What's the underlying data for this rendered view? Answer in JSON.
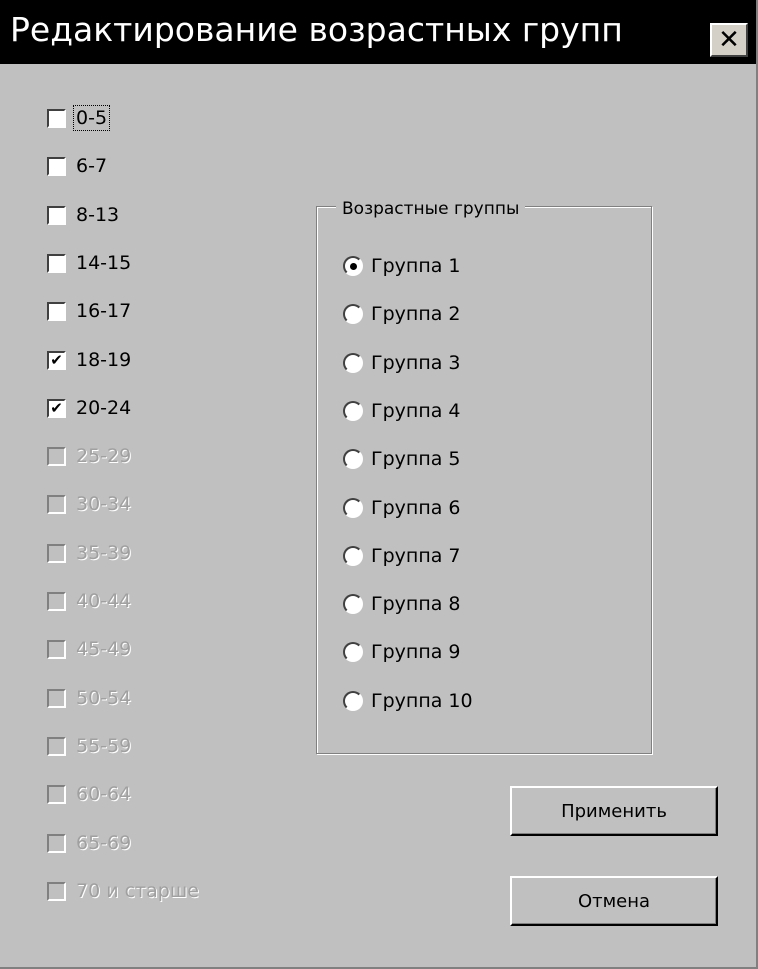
{
  "window": {
    "title": "Редактирование возрастных групп",
    "close_label": "✕"
  },
  "age_checkboxes": [
    {
      "label": "0-5",
      "checked": false,
      "enabled": true,
      "focused": true
    },
    {
      "label": "6-7",
      "checked": false,
      "enabled": true
    },
    {
      "label": "8-13",
      "checked": false,
      "enabled": true
    },
    {
      "label": "14-15",
      "checked": false,
      "enabled": true
    },
    {
      "label": "16-17",
      "checked": false,
      "enabled": true
    },
    {
      "label": "18-19",
      "checked": true,
      "enabled": true
    },
    {
      "label": "20-24",
      "checked": true,
      "enabled": true
    },
    {
      "label": "25-29",
      "checked": false,
      "enabled": false
    },
    {
      "label": "30-34",
      "checked": false,
      "enabled": false
    },
    {
      "label": "35-39",
      "checked": false,
      "enabled": false
    },
    {
      "label": "40-44",
      "checked": false,
      "enabled": false
    },
    {
      "label": "45-49",
      "checked": false,
      "enabled": false
    },
    {
      "label": "50-54",
      "checked": false,
      "enabled": false
    },
    {
      "label": "55-59",
      "checked": false,
      "enabled": false
    },
    {
      "label": "60-64",
      "checked": false,
      "enabled": false
    },
    {
      "label": "65-69",
      "checked": false,
      "enabled": false
    },
    {
      "label": "70 и старше",
      "checked": false,
      "enabled": false
    }
  ],
  "groups": {
    "title": "Возрастные группы",
    "options": [
      {
        "label": "Группа 1",
        "selected": true
      },
      {
        "label": "Группа 2",
        "selected": false
      },
      {
        "label": "Группа 3",
        "selected": false
      },
      {
        "label": "Группа 4",
        "selected": false
      },
      {
        "label": "Группа 5",
        "selected": false
      },
      {
        "label": "Группа 6",
        "selected": false
      },
      {
        "label": "Группа 7",
        "selected": false
      },
      {
        "label": "Группа 8",
        "selected": false
      },
      {
        "label": "Группа 9",
        "selected": false
      },
      {
        "label": "Группа 10",
        "selected": false
      }
    ]
  },
  "buttons": {
    "apply_label": "Применить",
    "cancel_label": "Отмена"
  }
}
